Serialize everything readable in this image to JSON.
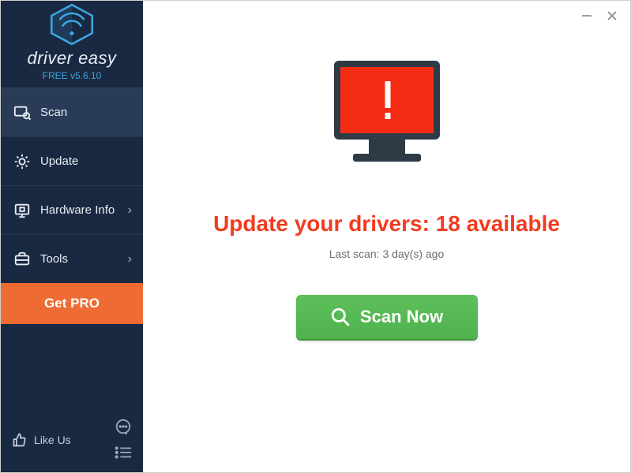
{
  "brand": {
    "name": "driver easy",
    "version": "FREE v5.6.10"
  },
  "sidebar": {
    "items": [
      {
        "label": "Scan"
      },
      {
        "label": "Update"
      },
      {
        "label": "Hardware Info"
      },
      {
        "label": "Tools"
      }
    ],
    "get_pro": "Get PRO",
    "like_us": "Like Us"
  },
  "main": {
    "headline": "Update your drivers: 18 available",
    "last_scan": "Last scan: 3 day(s) ago",
    "scan_button": "Scan Now"
  },
  "colors": {
    "accent": "#ee6c34",
    "alert": "#f23b1f",
    "sidebar": "#1a2942",
    "cta": "#5ec05a"
  }
}
